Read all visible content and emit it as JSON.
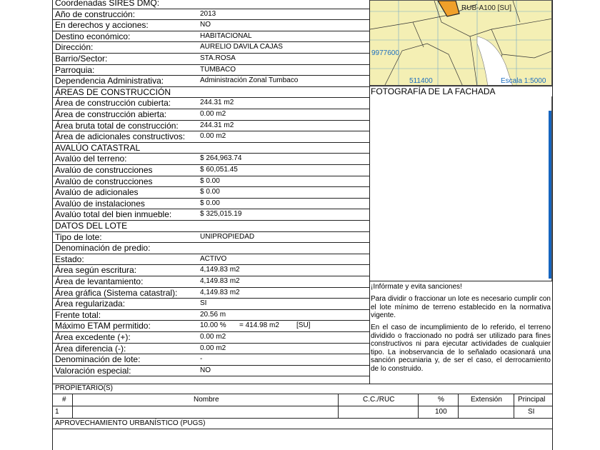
{
  "info_rows": [
    {
      "label": "Coordenadas SIRES DMQ:",
      "value": ""
    },
    {
      "label": "Año de construcción:",
      "value": "2013"
    },
    {
      "label": "En derechos y acciones:",
      "value": "NO"
    },
    {
      "label": "Destino económico:",
      "value": "HABITACIONAL"
    },
    {
      "label": "Dirección:",
      "value": "AURELIO DAVILA CAJAS"
    },
    {
      "label": "Barrio/Sector:",
      "value": "STA.ROSA"
    },
    {
      "label": "Parroquia:",
      "value": "TUMBACO"
    },
    {
      "label": "Dependencia Administrativa:",
      "value": "Administración Zonal Tumbaco"
    }
  ],
  "construccion": {
    "title": "ÁREAS DE CONSTRUCCIÓN",
    "rows": [
      {
        "label": "Área de construcción cubierta:",
        "value": "244.31 m2"
      },
      {
        "label": "Área de construcción abierta:",
        "value": "0.00 m2"
      },
      {
        "label": "Área bruta total de construcción:",
        "value": "244.31 m2"
      },
      {
        "label": "Área de adicionales constructivos:",
        "value": "0.00 m2"
      }
    ]
  },
  "avaluo": {
    "title": "AVALÚO CATASTRAL",
    "rows": [
      {
        "label": "Avalúo del terreno:",
        "value": "$ 264,963.74"
      },
      {
        "label": "Avalúo de construcciones",
        "value": "$ 60,051.45"
      },
      {
        "label": "Avalúo de construcciones",
        "value": "$ 0.00"
      },
      {
        "label": "Avalúo de adicionales",
        "value": "$ 0.00"
      },
      {
        "label": "Avalúo de instalaciones",
        "value": "$ 0.00"
      },
      {
        "label": "Avalúo total del bien inmueble:",
        "value": "$ 325,015.19"
      }
    ]
  },
  "lote": {
    "title": "DATOS DEL LOTE",
    "rows": [
      {
        "label": "Tipo de lote:",
        "value": "UNIPROPIEDAD"
      },
      {
        "label": "Denominación de predio:",
        "value": ""
      },
      {
        "label": "Estado:",
        "value": "ACTIVO"
      },
      {
        "label": "Área según escritura:",
        "value": "4,149.83 m2"
      },
      {
        "label": "Área de levantamiento:",
        "value": "4,149.83 m2"
      },
      {
        "label": "Área gráfica (Sistema catastral):",
        "value": "4,149.83 m2"
      },
      {
        "label": "Área regularizada:",
        "value": "SI"
      },
      {
        "label": "Frente total:",
        "value": "20.56 m"
      },
      {
        "label": "Máximo ETAM permitido:",
        "value": "10.00 %",
        "extra1": "= 414.98 m2",
        "extra2": "[SU]"
      },
      {
        "label": "Área excedente (+):",
        "value": "0.00 m2"
      },
      {
        "label": "Área diferencia (-):",
        "value": "0.00 m2"
      },
      {
        "label": "Denominación de lote:",
        "value": "-"
      },
      {
        "label": "Valoración especial:",
        "value": "NO"
      }
    ]
  },
  "map": {
    "label_zone": "RUB-A100 [SU]",
    "label_y": "9977600",
    "label_x": "511400",
    "label_scale": "Escala 1:5000"
  },
  "photo_title": "FOTOGRAFÍA DE LA FACHADA",
  "notice": {
    "heading": "¡Infórmate y evita sanciones!",
    "p1": "Para dividir o fraccionar un lote es necesario cumplir con el lote mínimo de terreno establecido en la normativa vigente.",
    "p2": "En el caso de incumplimiento de lo referido, el terreno dividido o fraccionado no podrá ser utilizado para fines constructivos ni para ejecutar actividades de cualquier tipo. La inobservancia de lo señalado ocasionará una sanción pecuniaria y, de ser el caso, el derrocamiento de lo construido."
  },
  "propietarios": {
    "title": "PROPIETARIO(S)",
    "headers": [
      "#",
      "Nombre",
      "C.C./RUC",
      "%",
      "Extensión",
      "Principal"
    ],
    "rows": [
      [
        "1",
        "",
        "",
        "100",
        "",
        "SI"
      ]
    ]
  },
  "pugs_title": "APROVECHAMIENTO URBANÍSTICO (PUGS)",
  "colors": {
    "map_bg": "#f4efb4",
    "map_grid": "#3f8fd0",
    "parcel_orange": "#f0a02a",
    "blue_edge": "#1565c0"
  }
}
